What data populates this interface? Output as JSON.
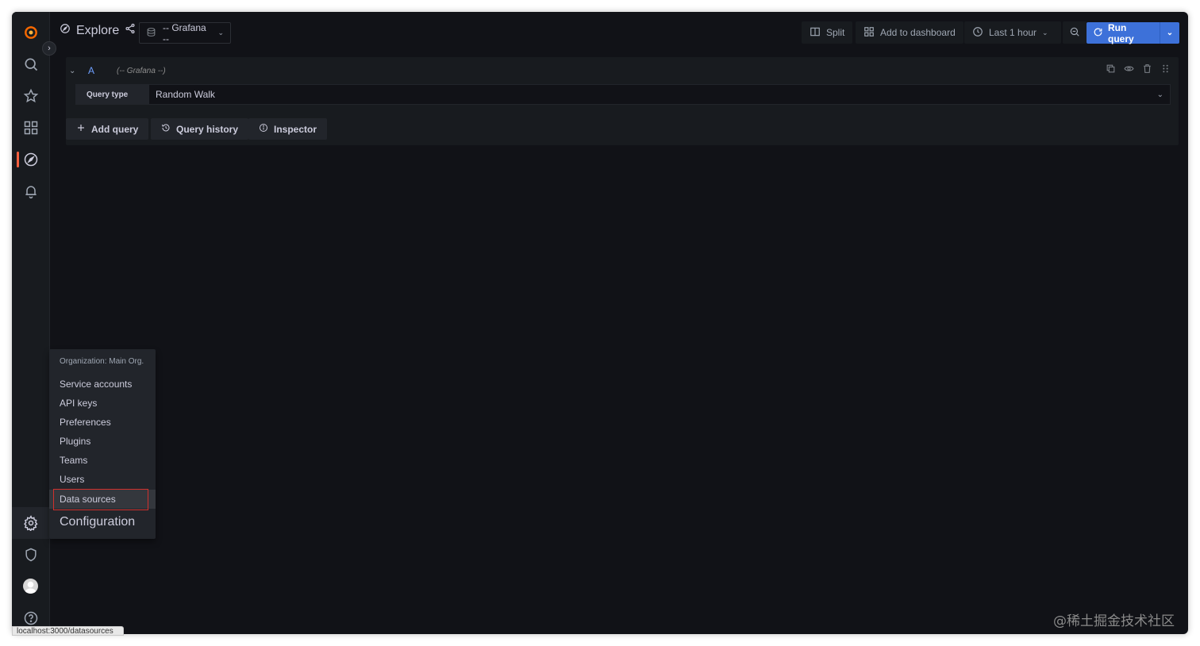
{
  "topbar": {
    "title": "Explore",
    "datasource": "-- Grafana --",
    "split_label": "Split",
    "add_dashboard_label": "Add to dashboard",
    "time_range_label": "Last 1 hour",
    "run_query_label": "Run query"
  },
  "query": {
    "ref_id": "A",
    "datasource_hint": "(-- Grafana --)",
    "query_type_label": "Query type",
    "query_type_value": "Random Walk",
    "add_query_label": "Add query",
    "history_label": "Query history",
    "inspector_label": "Inspector"
  },
  "config_menu": {
    "org": "Organization: Main Org.",
    "items": [
      "Service accounts",
      "API keys",
      "Preferences",
      "Plugins",
      "Teams",
      "Users",
      "Data sources"
    ],
    "title": "Configuration"
  },
  "status_bar": {
    "url": "localhost:3000/datasources"
  },
  "watermark": "@稀土掘金技术社区",
  "colors": {
    "accent": "#3d71d9",
    "active": "#f55f3e",
    "bg": "#111217",
    "highlight": "#d0312d"
  }
}
